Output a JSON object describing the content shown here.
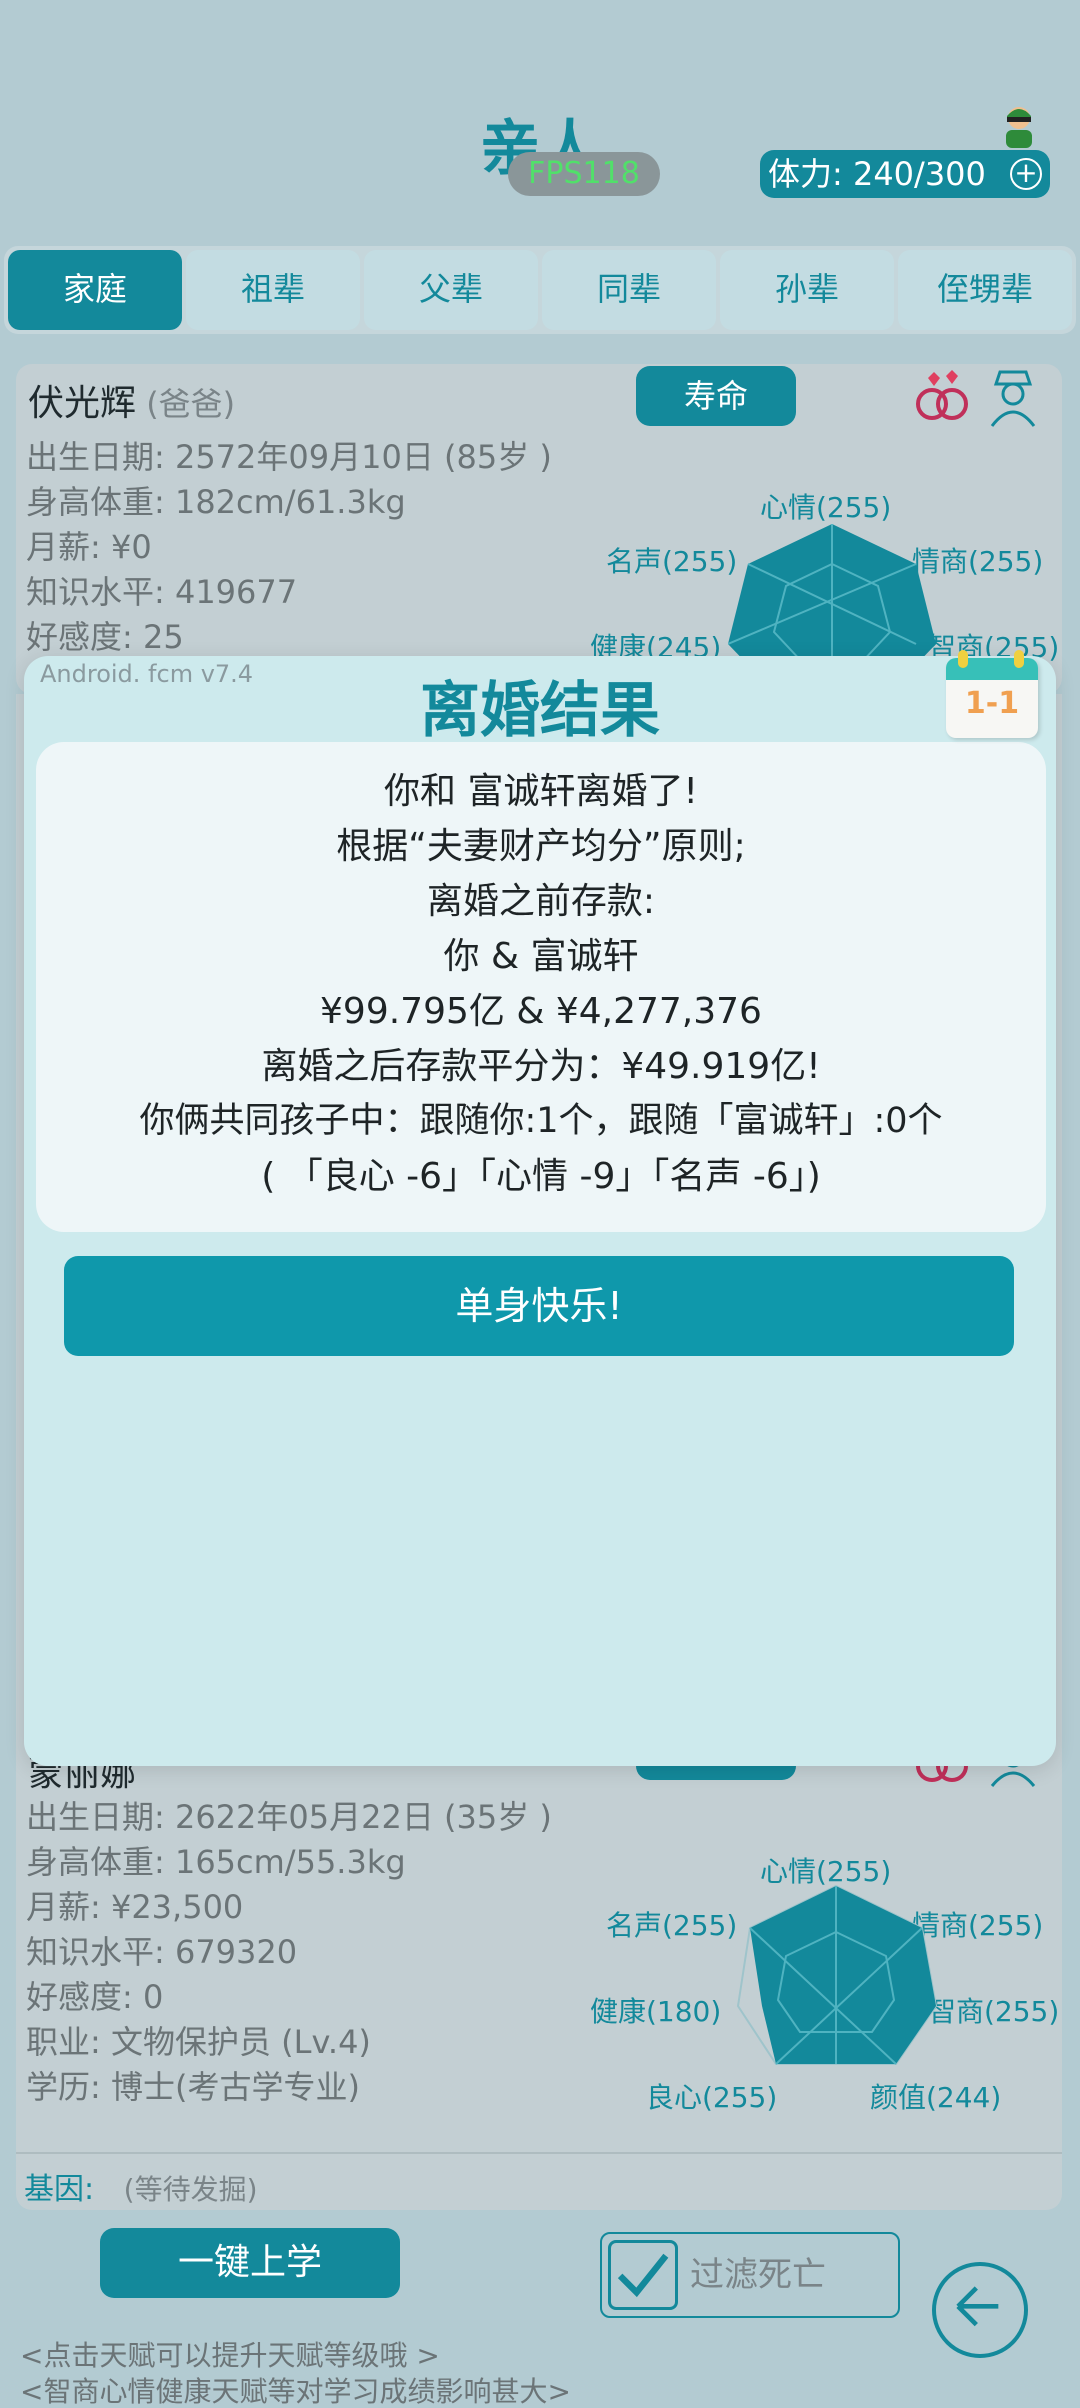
{
  "header": {
    "title": "亲人",
    "fps": "FPS118",
    "stamina": "体力: 240/300"
  },
  "tabs": [
    "家庭",
    "祖辈",
    "父辈",
    "同辈",
    "孙辈",
    "侄甥辈"
  ],
  "card1": {
    "name": "伏光辉",
    "role": "(爸爸)",
    "life_button": "寿命",
    "birth": "出生日期: 2572年09月10日 (85岁 )",
    "body": "身高体重: 182cm/61.3kg",
    "salary": "月薪: ¥0",
    "knowledge": "知识水平: 419677",
    "favor": "好感度: 25",
    "radar": {
      "mood": "心情(255)",
      "fame": "名声(255)",
      "eq": "情商(255)",
      "health": "健康(245)",
      "iq": "智商(255)"
    }
  },
  "card2": {
    "name": "蒙丽娜",
    "birth": "出生日期: 2622年05月22日 (35岁 )",
    "body": "身高体重: 165cm/55.3kg",
    "salary": "月薪: ¥23,500",
    "knowledge": "知识水平: 679320",
    "favor": "好感度: 0",
    "job": "职业: 文物保护员 (Lv.4)",
    "education": "学历: 博士(考古学专业)",
    "radar": {
      "mood": "心情(255)",
      "fame": "名声(255)",
      "eq": "情商(255)",
      "health": "健康(180)",
      "iq": "智商(255)",
      "conscience": "良心(255)",
      "looks": "颜值(244)"
    },
    "gene_label": "基因:",
    "gene_value": "(等待发掘)"
  },
  "dialog": {
    "version": "Android. fcm v7.4",
    "title": "离婚结果",
    "calendar": "1-1",
    "lines": [
      "你和 富诚轩离婚了!",
      "根据“夫妻财产均分”原则;",
      "离婚之前存款:",
      "你 & 富诚轩",
      "¥99.795亿 & ¥4,277,376",
      "离婚之后存款平分为：¥49.919亿!",
      "你俩共同孩子中：跟随你:1个，跟随「富诚轩」:0个",
      "(  「良心 -6」「心情 -9」「名声 -6」)"
    ],
    "button": "单身快乐!"
  },
  "bottom": {
    "study_button": "一键上学",
    "filter_label": "过滤死亡",
    "tip1": "<点击天赋可以提升天赋等级哦 >",
    "tip2": "<智商心情健康天赋等对学习成绩影响甚大>"
  },
  "colors": {
    "accent": "#13899b",
    "fps": "#51e06a",
    "calendar_text": "#f0a050"
  }
}
